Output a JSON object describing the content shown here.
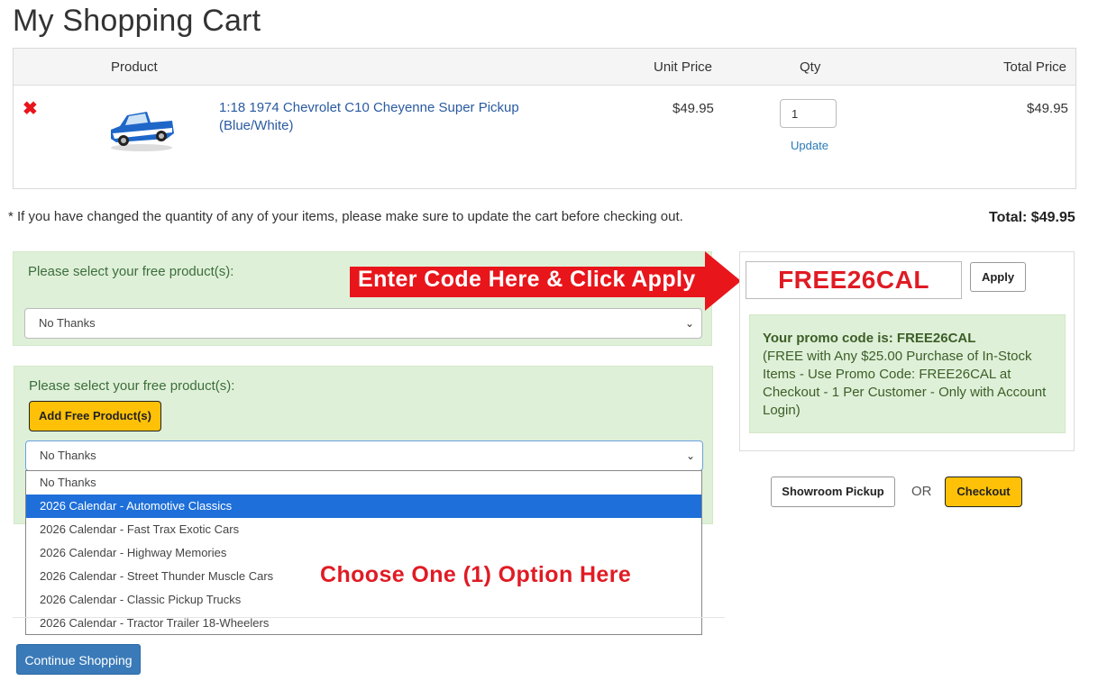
{
  "page": {
    "title": "My Shopping Cart"
  },
  "cart": {
    "headers": {
      "product": "Product",
      "unit_price": "Unit Price",
      "qty": "Qty",
      "total_price": "Total Price"
    },
    "item": {
      "name": "1:18 1974 Chevrolet C10 Cheyenne Super Pickup (Blue/White)",
      "unit_price": "$49.95",
      "qty": "1",
      "update": "Update",
      "total_price": "$49.95"
    },
    "note": "* If you have changed the quantity of any of your items, please make sure to update the cart before checking out.",
    "total": "Total: $49.95"
  },
  "free1": {
    "label": "Please select your free product(s):",
    "selected": "No Thanks"
  },
  "free2": {
    "label": "Please select your free product(s):",
    "add_button": "Add Free Product(s)",
    "selected": "No Thanks",
    "options": [
      "No Thanks",
      "2026 Calendar - Automotive Classics",
      "2026 Calendar - Fast Trax Exotic Cars",
      "2026 Calendar - Highway Memories",
      "2026 Calendar - Street Thunder Muscle Cars",
      "2026 Calendar - Classic Pickup Trucks",
      "2026 Calendar - Tractor Trailer 18-Wheelers"
    ],
    "highlighted_index": 1
  },
  "annotations": {
    "arrow_text": "Enter Code Here & Click Apply",
    "choose_text": "Choose One (1) Option Here",
    "arrow_color": "#e8151b",
    "text_color": "#e01b24"
  },
  "promo": {
    "code_value": "FREE26CAL",
    "apply": "Apply",
    "msg_bold": "Your promo code is: FREE26CAL",
    "msg_text": "(FREE with Any $25.00 Purchase of In-Stock Items - Use Promo Code: FREE26CAL at Checkout - 1 Per Customer - Only with Account Login)"
  },
  "actions": {
    "showroom": "Showroom Pickup",
    "or": "OR",
    "checkout": "Checkout",
    "continue": "Continue Shopping"
  },
  "icons": {
    "remove": "remove-x-icon",
    "caret": "chevron-down-icon",
    "product_image": "pickup-truck-image"
  },
  "colors": {
    "link": "#2a5aa0",
    "green_bg": "#dff0d8",
    "yellow": "#ffc107",
    "blue_btn": "#3a7ab8",
    "highlight": "#1e6fd9"
  }
}
